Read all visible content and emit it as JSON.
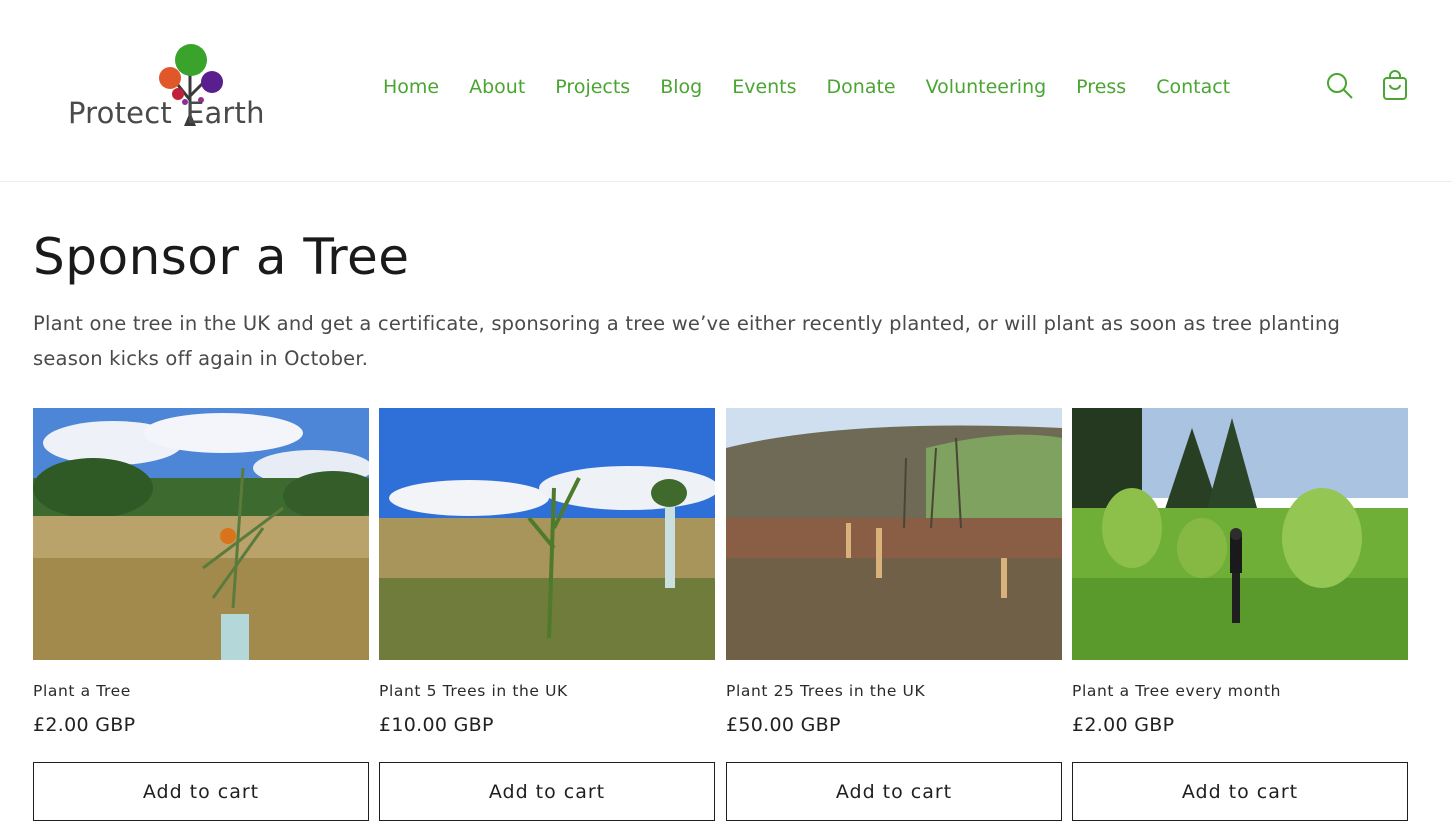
{
  "brand": {
    "name_part1": "Protect",
    "name_part2": "Earth"
  },
  "nav": {
    "items": [
      {
        "label": "Home"
      },
      {
        "label": "About"
      },
      {
        "label": "Projects"
      },
      {
        "label": "Blog"
      },
      {
        "label": "Events"
      },
      {
        "label": "Donate"
      },
      {
        "label": "Volunteering"
      },
      {
        "label": "Press"
      },
      {
        "label": "Contact"
      }
    ],
    "accent_color": "#4aa532"
  },
  "header_icons": {
    "search": "search-icon",
    "cart": "cart-icon"
  },
  "page": {
    "title": "Sponsor a Tree",
    "description": "Plant one tree in the UK and get a certificate, sponsoring a tree we’ve either recently planted, or will plant as soon as tree planting season kicks off again in October."
  },
  "products": [
    {
      "title": "Plant a Tree",
      "price": "£2.00 GBP",
      "button": "Add to cart"
    },
    {
      "title": "Plant 5 Trees in the UK",
      "price": "£10.00 GBP",
      "button": "Add to cart"
    },
    {
      "title": "Plant 25 Trees in the UK",
      "price": "£50.00 GBP",
      "button": "Add to cart"
    },
    {
      "title": "Plant a Tree every month",
      "price": "£2.00 GBP",
      "button": "Add to cart"
    }
  ]
}
